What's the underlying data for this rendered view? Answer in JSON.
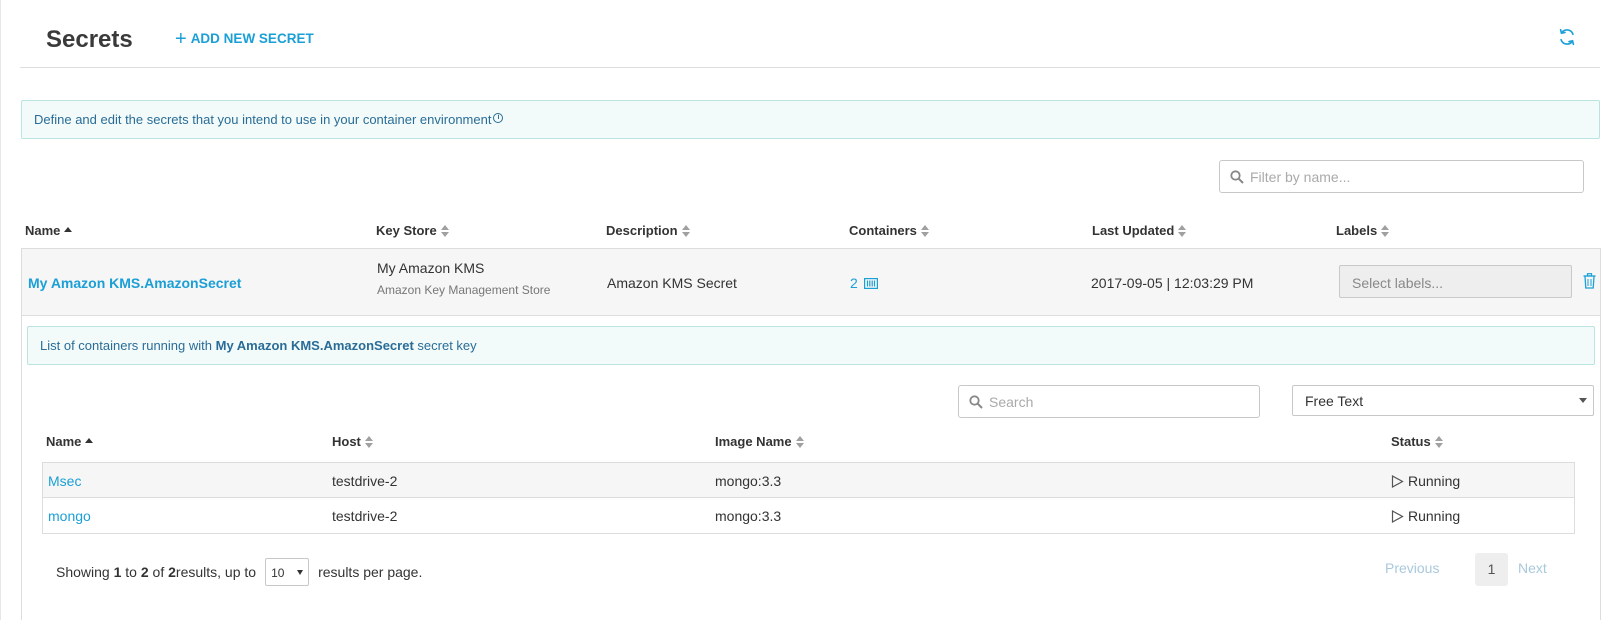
{
  "header": {
    "title": "Secrets",
    "add_label": "ADD NEW SECRET"
  },
  "info": {
    "text": "Define and edit the secrets that you intend to use in your container environment"
  },
  "filter": {
    "placeholder": "Filter by name..."
  },
  "table": {
    "columns": [
      "Name",
      "Key Store",
      "Description",
      "Containers",
      "Last Updated",
      "Labels"
    ],
    "rows": [
      {
        "name": "My Amazon KMS.AmazonSecret",
        "key_store": "My Amazon KMS",
        "key_store_sub": "Amazon Key Management Store",
        "description": "Amazon KMS Secret",
        "containers": "2",
        "last_updated": "2017-09-05 | 12:03:29 PM",
        "labels_placeholder": "Select labels..."
      }
    ]
  },
  "expanded": {
    "banner_prefix": "List of containers running with",
    "banner_secret": "My Amazon KMS.AmazonSecret",
    "banner_suffix": "secret key",
    "search_placeholder": "Search",
    "search_type": "Free Text",
    "columns": [
      "Name",
      "Host",
      "Image Name",
      "Status"
    ],
    "rows": [
      {
        "name": "Msec",
        "host": "testdrive-2",
        "image": "mongo:3.3",
        "status": "Running"
      },
      {
        "name": "mongo",
        "host": "testdrive-2",
        "image": "mongo:3.3",
        "status": "Running"
      }
    ],
    "pagination": {
      "showing_label": "Showing",
      "from": "1",
      "to_label": "to",
      "to": "2",
      "of_label": "of",
      "total": "2",
      "results_label": "results, up to",
      "per_page": "10",
      "per_page_label": "results per page.",
      "previous": "Previous",
      "current_page": "1",
      "next": "Next"
    }
  },
  "colors": {
    "accent": "#1a9fd6",
    "info_text": "#2a6c97",
    "info_bg": "#f2fbfa"
  },
  "icons": [
    "plus-icon",
    "refresh-icon",
    "info-icon",
    "search-icon",
    "containers-icon",
    "trash-icon",
    "play-icon"
  ]
}
